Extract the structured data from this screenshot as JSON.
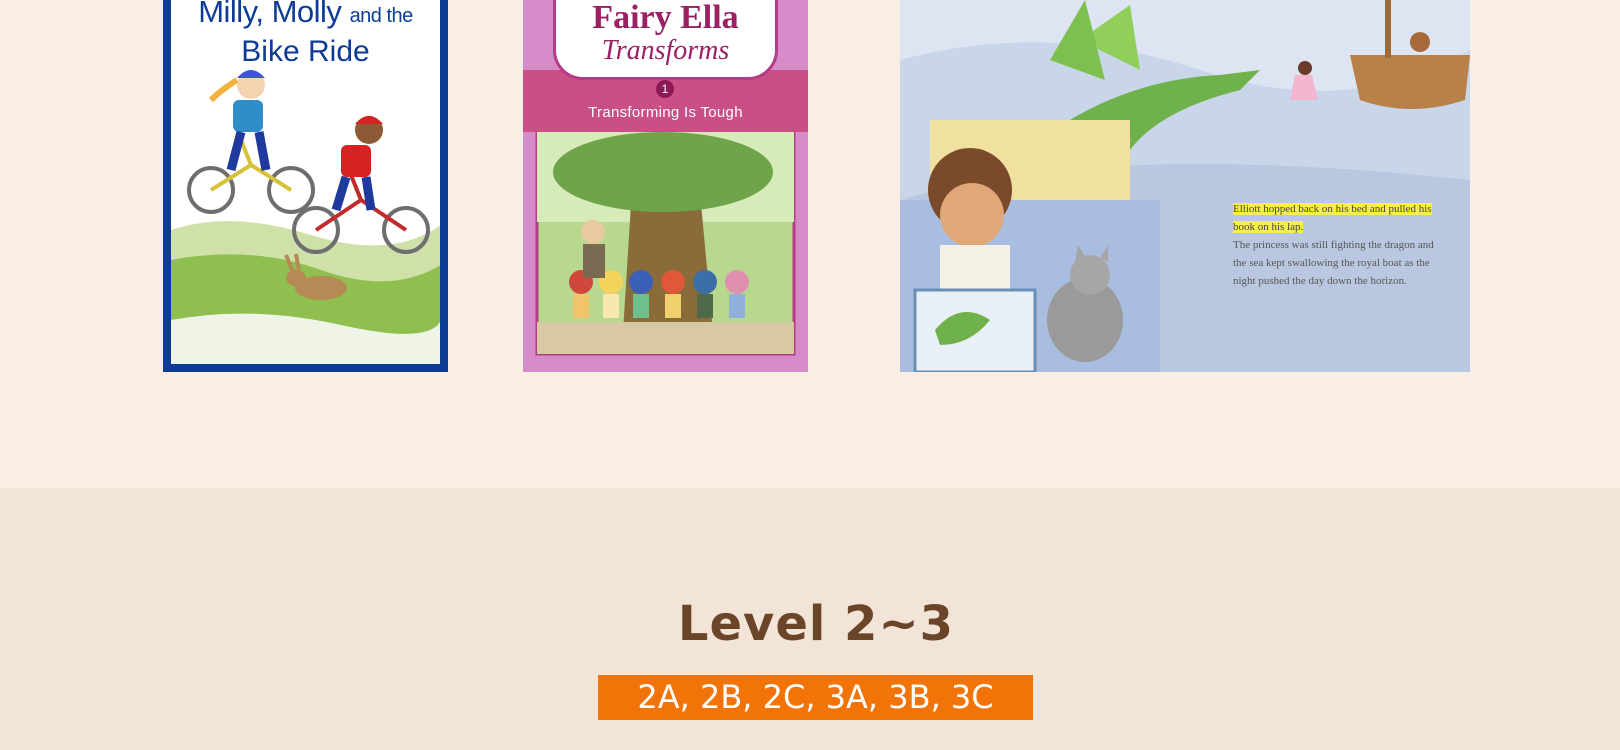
{
  "books": [
    {
      "title_line1": "Milly, Molly",
      "title_and": "and the",
      "title_line2": "Bike Ride",
      "cover_color": "#0d3b96"
    },
    {
      "title_line1": "Fairy Ella",
      "title_line2": "Transforms",
      "series_number": "1",
      "subtitle": "Transforming Is Tough",
      "cover_color": "#d68cc8"
    }
  ],
  "spread": {
    "highlighted_text": "Elliott hopped back on his bed and pulled his book on his lap.",
    "body_text": "The princess was still fighting the dragon and the sea kept swallowing the royal boat as the night pushed the day down the horizon.",
    "highlight_color": "#f6ee4a"
  },
  "level": {
    "title": "Level 2~3",
    "badge": "2A, 2B, 2C, 3A, 3B, 3C",
    "badge_color": "#f27408",
    "title_color": "#6b4529"
  }
}
